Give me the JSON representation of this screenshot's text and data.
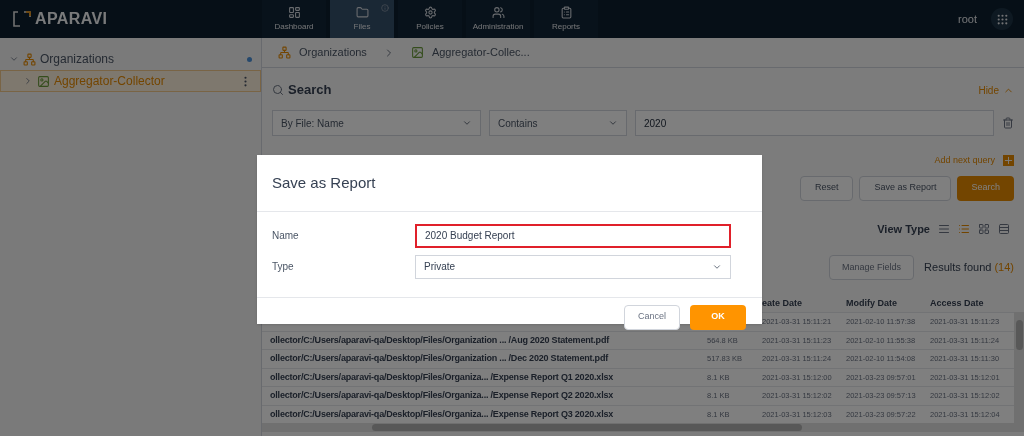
{
  "header": {
    "logo": "APARAVI",
    "nav": [
      {
        "kind": "dashboard",
        "label": "Dashboard",
        "selected": false,
        "info": false
      },
      {
        "kind": "files",
        "label": "Files",
        "selected": true,
        "info": true
      },
      {
        "kind": "policies",
        "label": "Policies",
        "selected": false,
        "info": false
      },
      {
        "kind": "administration",
        "label": "Administration",
        "selected": false,
        "info": false
      },
      {
        "kind": "reports",
        "label": "Reports",
        "selected": false,
        "info": false
      }
    ],
    "user": "root"
  },
  "sidebar": {
    "tree": [
      {
        "label": "Organizations",
        "kind": "organization",
        "expanded": true,
        "selected": false,
        "children": [
          {
            "label": "Aggregator-Collector",
            "kind": "collector",
            "expanded": false,
            "selected": true
          }
        ]
      }
    ]
  },
  "breadcrumb": [
    {
      "label": "Organizations",
      "kind": "organization"
    },
    {
      "label": "Aggregator-Collec...",
      "kind": "collector"
    }
  ],
  "search": {
    "title": "Search",
    "hide": "Hide",
    "query": {
      "field": "By File: Name",
      "operator": "Contains",
      "value": "2020"
    },
    "add_query": "Add next query",
    "buttons": [
      {
        "label": "Reset",
        "primary": false
      },
      {
        "label": "Save as Report",
        "primary": false
      },
      {
        "label": "Search",
        "primary": true
      }
    ]
  },
  "view_type": {
    "label": "View Type",
    "options": [
      {
        "kind": "lines",
        "selected": false
      },
      {
        "kind": "list",
        "selected": true
      },
      {
        "kind": "grid",
        "selected": false
      },
      {
        "kind": "rows",
        "selected": false
      }
    ]
  },
  "results": {
    "manage_fields": "Manage Fields",
    "label": "Results found",
    "count": "(14)"
  },
  "table": {
    "columns": [
      "eate Date",
      "Modify Date",
      "Access Date"
    ],
    "rows": [
      {
        "create": "2021-03-31 15:11:21",
        "modify": "2021-02-10 11:57:38",
        "access": "2021-03-31 15:11:23"
      },
      {
        "name": "ollector/C:/Users/aparavi-qa/Desktop/Files/Organization ...  /Aug 2020 Statement.pdf",
        "size": "564.8 KB",
        "create": "2021-03-31 15:11:23",
        "modify": "2021-02-10 11:55:38",
        "access": "2021-03-31 15:11:24"
      },
      {
        "name": "ollector/C:/Users/aparavi-qa/Desktop/Files/Organization ...  /Dec 2020 Statement.pdf",
        "size": "517.83 KB",
        "create": "2021-03-31 15:11:24",
        "modify": "2021-02-10 11:54:08",
        "access": "2021-03-31 15:11:30"
      },
      {
        "name": "ollector/C:/Users/aparavi-qa/Desktop/Files/Organiza... /Expense Report Q1 2020.xlsx",
        "size": "8.1 KB",
        "create": "2021-03-31 15:12:00",
        "modify": "2021-03-23 09:57:01",
        "access": "2021-03-31 15:12:01"
      },
      {
        "name": "ollector/C:/Users/aparavi-qa/Desktop/Files/Organiza... /Expense Report Q2 2020.xlsx",
        "size": "8.1 KB",
        "create": "2021-03-31 15:12:02",
        "modify": "2021-03-23 09:57:13",
        "access": "2021-03-31 15:12:02"
      },
      {
        "name": "ollector/C:/Users/aparavi-qa/Desktop/Files/Organiza... /Expense Report Q3 2020.xlsx",
        "size": "8.1 KB",
        "create": "2021-03-31 15:12:03",
        "modify": "2021-03-23 09:57:22",
        "access": "2021-03-31 15:12:04"
      }
    ]
  },
  "dialog": {
    "title": "Save as Report",
    "fields": [
      {
        "kind": "text",
        "label": "Name",
        "value": "2020 Budget Report",
        "focused": true
      },
      {
        "kind": "select",
        "label": "Type",
        "value": "Private",
        "focused": false
      }
    ],
    "buttons": [
      {
        "label": "Cancel",
        "primary": false
      },
      {
        "label": "OK",
        "primary": true
      }
    ]
  }
}
